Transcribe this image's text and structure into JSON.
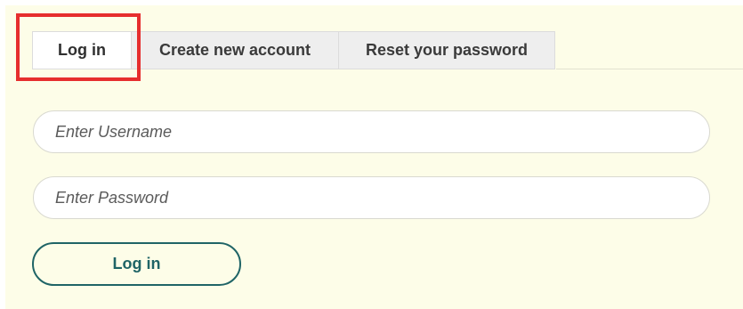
{
  "tabs": [
    {
      "label": "Log in",
      "active": true
    },
    {
      "label": "Create new account",
      "active": false
    },
    {
      "label": "Reset your password",
      "active": false
    }
  ],
  "form": {
    "username_placeholder": "Enter Username",
    "password_placeholder": "Enter Password",
    "submit_label": "Log in"
  },
  "colors": {
    "panel_background": "#fdfde8",
    "highlight_border": "#e62e2e",
    "button_accent": "#1f6466"
  }
}
